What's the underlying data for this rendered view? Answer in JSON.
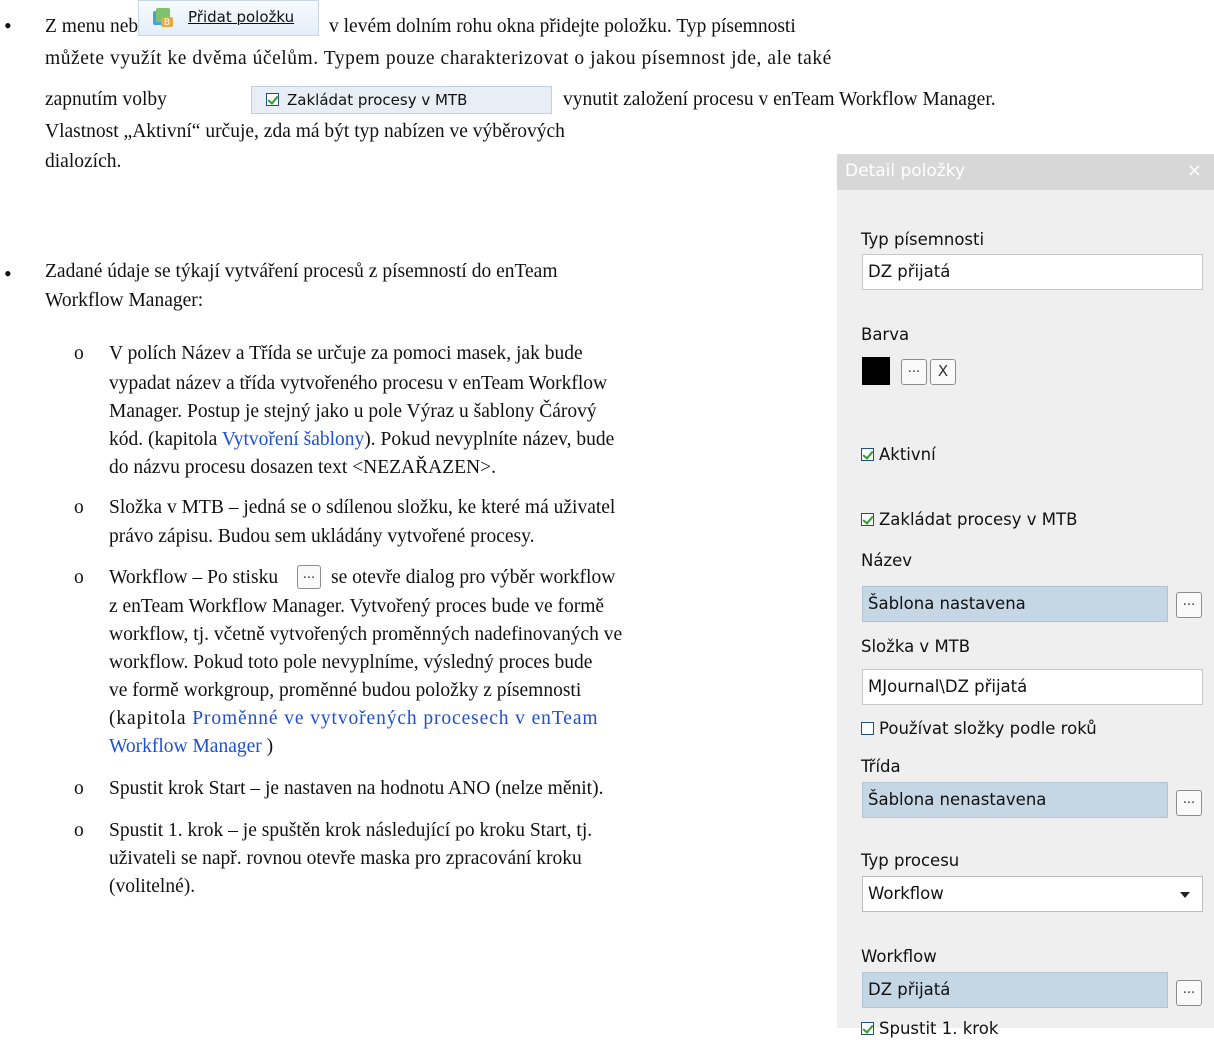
{
  "bullet_symbol": "•",
  "sub_bullet_symbol": "o",
  "intro": {
    "line1_a": "Z menu nebo tlačítkem",
    "line1_b": "v levém dolním rohu okna přidejte položku. Typ písemnosti",
    "line2": "můžete využít ke dvěma účelům. Typem pouze charakterizovat o jakou písemnost jde, ale také",
    "line3_a": "zapnutím volby",
    "line3_b": "vynutit založení procesu v enTeam Workflow Manager.",
    "line4": "Vlastnost „Aktivní“ určuje, zda má být typ nabízen ve výběrových",
    "line5": "dialozích.",
    "add_button_label": "Přidat položku",
    "checkbox_chip_label": "Zakládat procesy v MTB"
  },
  "second_bullet": {
    "line1": "Zadané údaje se týkají vytváření procesů z písemností do enTeam",
    "line2": "Workflow Manager:"
  },
  "sub_items": {
    "nazev": {
      "l1": "V polích Název a Třída se určuje za pomoci masek, jak bude",
      "l2": "vypadat název a třída vytvořeného procesu v enTeam Workflow",
      "l3": "Manager. Postup je stejný jako u pole Výraz u šablony Čárový",
      "l4_a": "kód. (kapitola ",
      "l4_link": "Vytvoření šablony",
      "l4_b": "). Pokud nevyplníte název, bude",
      "l5": "do názvu procesu dosazen text <NEZAŘAZEN>."
    },
    "slozka": {
      "l1": "Složka v MTB – jedná se o sdílenou složku, ke které má uživatel",
      "l2": "právo zápisu. Budou sem ukládány vytvořené procesy."
    },
    "workflow": {
      "l1_a": "Workflow – Po stisku",
      "l1_b": "se otevře dialog pro výběr workflow",
      "l2": "z enTeam Workflow Manager. Vytvořený proces bude ve formě",
      "l3": "workflow, tj. včetně vytvořených proměnných nadefinovaných ve",
      "l4": "workflow. Pokud toto pole nevyplníme, výsledný proces bude",
      "l5": "ve formě workgroup, proměnné budou položky z písemnosti",
      "l6_a": "(kapitola ",
      "l6_link": "Proměnné ve vytvořených procesech v enTeam",
      "l7_link": "Workflow Manager",
      "l7_b": " )"
    },
    "start": {
      "l1": "Spustit krok Start – je nastaven na hodnotu ANO (nelze měnit)."
    },
    "krok1": {
      "l1": "Spustit 1. krok – je spuštěn krok následující po kroku Start, tj.",
      "l2": "uživateli se např. rovnou otevře maska pro zpracování kroku",
      "l3": "(volitelné)."
    }
  },
  "panel": {
    "title": "Detail položky",
    "close": "×",
    "typ_label": "Typ písemnosti",
    "typ_value": "DZ přijatá",
    "barva_label": "Barva",
    "barva_color": "#000000",
    "dots": "...",
    "clear": "X",
    "aktivni_label": "Aktivní",
    "zakladat_label": "Zakládat procesy v MTB",
    "nazev_label": "Název",
    "nazev_value": "Šablona nastavena",
    "slozka_label": "Složka v MTB",
    "slozka_value": "MJournal\\DZ přijatá",
    "roky_label": "Používat složky podle roků",
    "trida_label": "Třída",
    "trida_value": "Šablona nenastavena",
    "typ_procesu_label": "Typ procesu",
    "typ_procesu_value": "Workflow",
    "workflow_label": "Workflow",
    "workflow_value": "DZ přijatá",
    "spustit_label": "Spustit 1. krok"
  }
}
